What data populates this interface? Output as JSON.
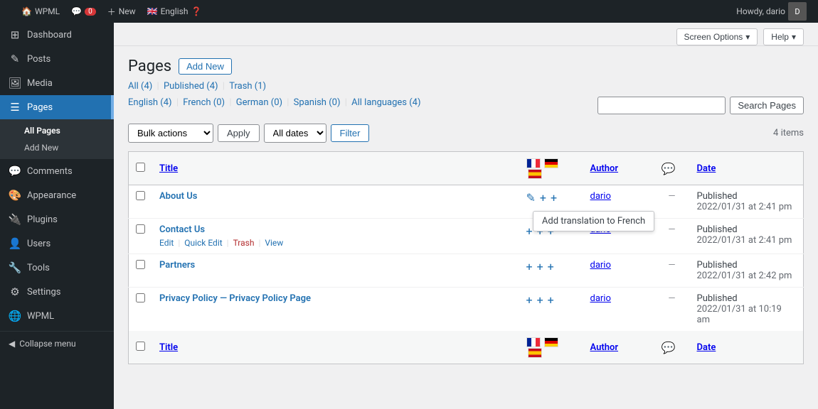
{
  "topbar": {
    "wp_label": "WPML",
    "new_label": "New",
    "language_label": "English",
    "notif_count": "0",
    "screen_options_label": "Screen Options",
    "help_label": "Help",
    "howdy_label": "Howdy, dario",
    "user_initial": "D"
  },
  "sidebar": {
    "items": [
      {
        "id": "dashboard",
        "label": "Dashboard",
        "icon": "⊞"
      },
      {
        "id": "posts",
        "label": "Posts",
        "icon": "✎"
      },
      {
        "id": "media",
        "label": "Media",
        "icon": "🖼"
      },
      {
        "id": "pages",
        "label": "Pages",
        "icon": "☰",
        "active": true
      },
      {
        "id": "comments",
        "label": "Comments",
        "icon": "💬"
      },
      {
        "id": "appearance",
        "label": "Appearance",
        "icon": "🎨"
      },
      {
        "id": "plugins",
        "label": "Plugins",
        "icon": "🔌"
      },
      {
        "id": "users",
        "label": "Users",
        "icon": "👤"
      },
      {
        "id": "tools",
        "label": "Tools",
        "icon": "🔧"
      },
      {
        "id": "settings",
        "label": "Settings",
        "icon": "⚙"
      },
      {
        "id": "wpml",
        "label": "WPML",
        "icon": "🌐"
      }
    ],
    "pages_sub": [
      {
        "label": "All Pages",
        "active": true
      },
      {
        "label": "Add New",
        "active": false
      }
    ],
    "collapse_label": "Collapse menu"
  },
  "main": {
    "page_title": "Pages",
    "add_new_label": "Add New",
    "filter_links": {
      "all": "All (4)",
      "published": "Published (4)",
      "trash": "Trash (1)"
    },
    "lang_filters": {
      "english": "English (4)",
      "french": "French (0)",
      "german": "German (0)",
      "spanish": "Spanish (0)",
      "all": "All languages (4)"
    },
    "bulk_actions_label": "Bulk actions",
    "apply_label": "Apply",
    "all_dates_label": "All dates",
    "filter_label": "Filter",
    "items_count": "4 items",
    "search_placeholder": "",
    "search_btn_label": "Search Pages",
    "table": {
      "headers": {
        "title": "Title",
        "author": "Author",
        "date": "Date"
      },
      "rows": [
        {
          "id": "about-us",
          "title": "About Us",
          "author": "dario",
          "date_label": "Published",
          "date_value": "2022/01/31 at 2:41 pm",
          "trans_fr": "add",
          "trans_de": "add",
          "trans_es": "add",
          "has_edit_icon": true,
          "actions": []
        },
        {
          "id": "contact-us",
          "title": "Contact Us",
          "author": "dario",
          "date_label": "Published",
          "date_value": "2022/01/31 at 2:41 pm",
          "trans_fr": "add",
          "trans_de": "add",
          "trans_es": "add",
          "has_edit_icon": false,
          "actions": [
            "Edit",
            "Quick Edit",
            "Trash",
            "View"
          ]
        },
        {
          "id": "partners",
          "title": "Partners",
          "author": "dario",
          "date_label": "Published",
          "date_value": "2022/01/31 at 2:42 pm",
          "trans_fr": "add",
          "trans_de": "add",
          "trans_es": "add",
          "has_edit_icon": false,
          "actions": []
        },
        {
          "id": "privacy-policy",
          "title": "Privacy Policy — Privacy Policy Page",
          "author": "dario",
          "date_label": "Published",
          "date_value": "2022/01/31 at 10:19 am",
          "trans_fr": "add",
          "trans_de": "add",
          "trans_es": "add",
          "has_edit_icon": false,
          "actions": []
        }
      ]
    },
    "tooltip_text": "Add translation to French"
  }
}
